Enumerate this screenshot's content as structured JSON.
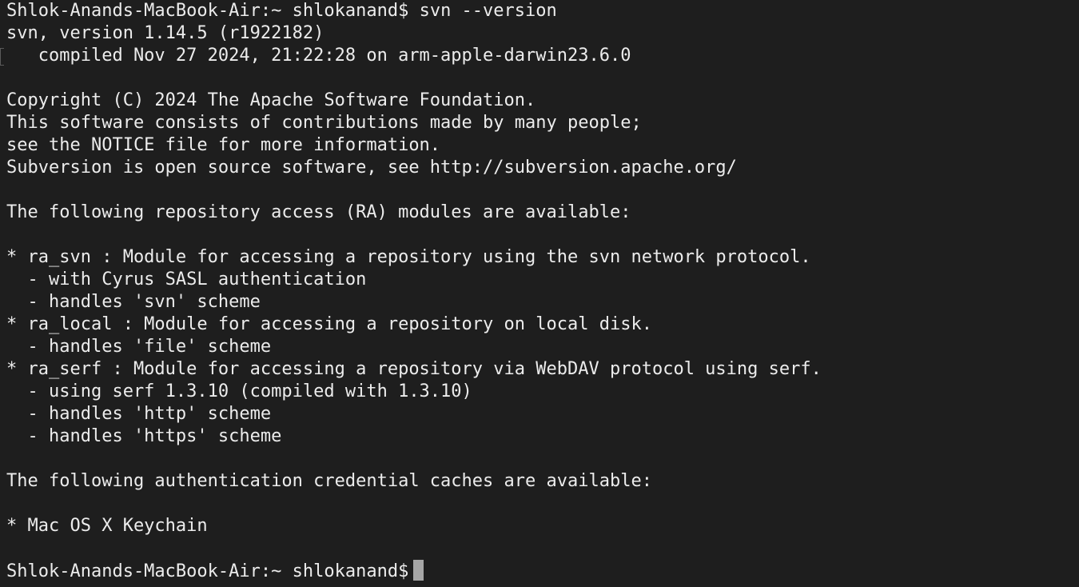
{
  "terminal": {
    "prompt": "Shlok-Anands-MacBook-Air:~ shlokanand$",
    "command": "svn --version",
    "output": [
      "svn, version 1.14.5 (r1922182)",
      "   compiled Nov 27 2024, 21:22:28 on arm-apple-darwin23.6.0",
      "",
      "Copyright (C) 2024 The Apache Software Foundation.",
      "This software consists of contributions made by many people;",
      "see the NOTICE file for more information.",
      "Subversion is open source software, see http://subversion.apache.org/",
      "",
      "The following repository access (RA) modules are available:",
      "",
      "* ra_svn : Module for accessing a repository using the svn network protocol.",
      "  - with Cyrus SASL authentication",
      "  - handles 'svn' scheme",
      "* ra_local : Module for accessing a repository on local disk.",
      "  - handles 'file' scheme",
      "* ra_serf : Module for accessing a repository via WebDAV protocol using serf.",
      "  - using serf 1.3.10 (compiled with 1.3.10)",
      "  - handles 'http' scheme",
      "  - handles 'https' scheme",
      "",
      "The following authentication credential caches are available:",
      "",
      "* Mac OS X Keychain",
      ""
    ],
    "final_prompt": "Shlok-Anands-MacBook-Air:~ shlokanand$"
  }
}
